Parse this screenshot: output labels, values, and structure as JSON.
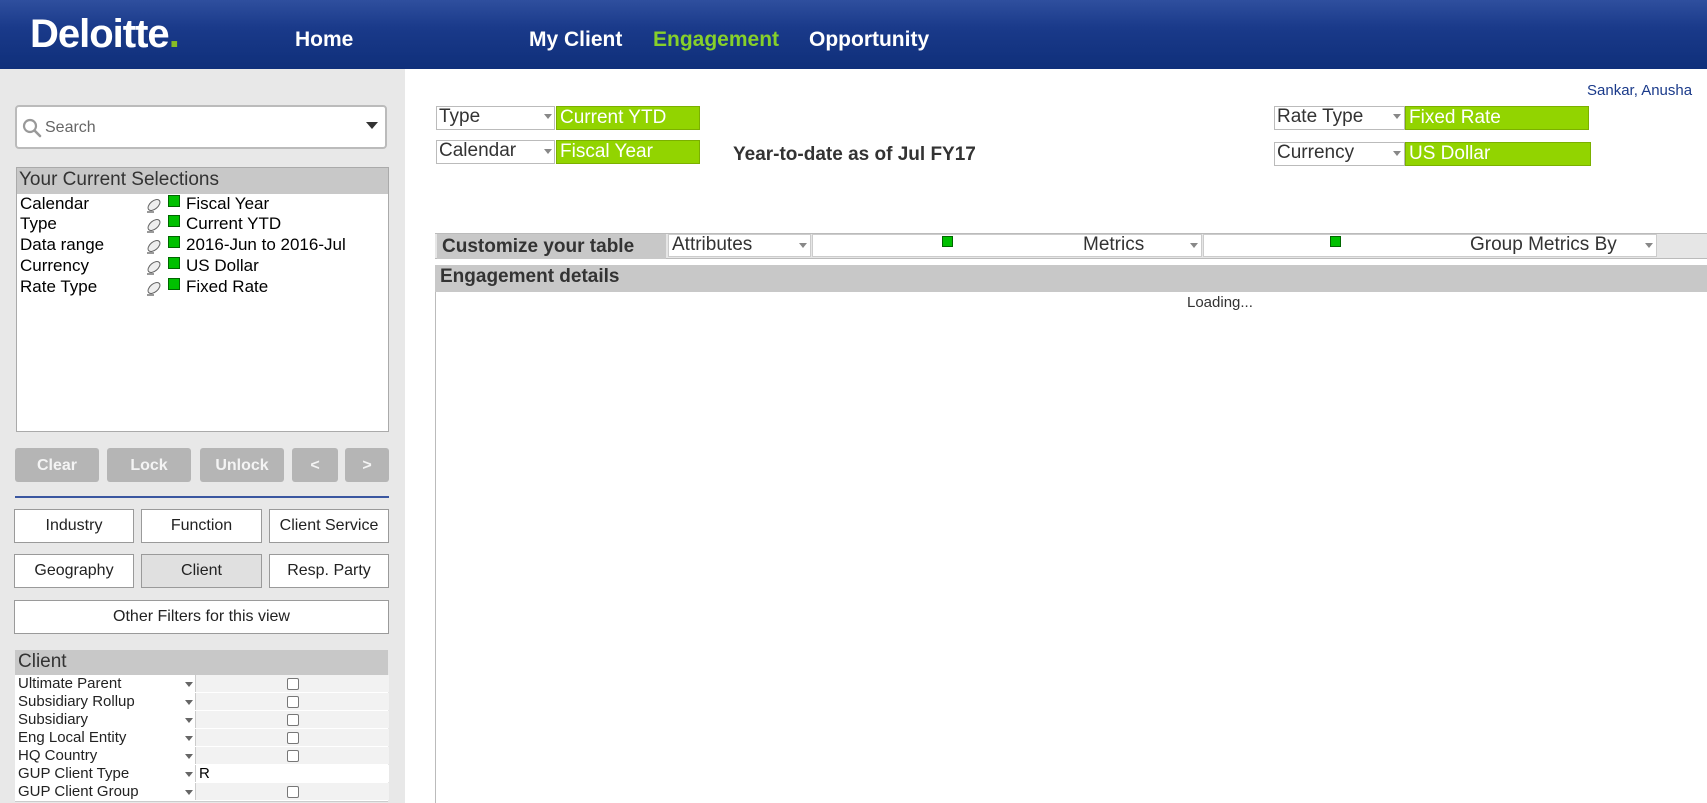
{
  "header": {
    "logo": "Deloitte",
    "logo_dot": ".",
    "nav": {
      "home": "Home",
      "my_client": "My Client",
      "engagement": "Engagement",
      "opportunity": "Opportunity"
    },
    "active_color": "#86d02a"
  },
  "search": {
    "placeholder": "Search"
  },
  "current_selections": {
    "title": "Your Current Selections",
    "items": [
      {
        "label": "Calendar",
        "value": "Fiscal Year"
      },
      {
        "label": "Type",
        "value": "Current YTD"
      },
      {
        "label": "Data range",
        "value": "2016-Jun to 2016-Jul"
      },
      {
        "label": "Currency",
        "value": "US Dollar"
      },
      {
        "label": "Rate Type",
        "value": "Fixed Rate"
      }
    ]
  },
  "selection_buttons": {
    "clear": "Clear",
    "lock": "Lock",
    "unlock": "Unlock",
    "prev": "<",
    "next": ">"
  },
  "filter_tabs": {
    "industry": "Industry",
    "function": "Function",
    "client_service": "Client Service",
    "geography": "Geography",
    "client": "Client",
    "resp_party": "Resp. Party",
    "other": "Other Filters for this view"
  },
  "client_panel": {
    "title": "Client",
    "fields": [
      {
        "label": "Ultimate Parent",
        "value": ""
      },
      {
        "label": "Subsidiary Rollup",
        "value": ""
      },
      {
        "label": "Subsidiary",
        "value": ""
      },
      {
        "label": "Eng Local Entity",
        "value": ""
      },
      {
        "label": "HQ Country",
        "value": ""
      },
      {
        "label": "GUP Client Type",
        "value": "R"
      },
      {
        "label": "GUP Client Group",
        "value": ""
      }
    ]
  },
  "user": {
    "name": "Sankar, Anusha"
  },
  "controls": {
    "type_label": "Type",
    "type_value": "Current YTD",
    "calendar_label": "Calendar",
    "calendar_value": "Fiscal Year",
    "rate_type_label": "Rate Type",
    "rate_type_value": "Fixed Rate",
    "currency_label": "Currency",
    "currency_value": "US Dollar",
    "ytd_text": "Year-to-date as of Jul FY17"
  },
  "customize": {
    "label": "Customize your table",
    "attributes": "Attributes",
    "metrics": "Metrics",
    "group_by": "Group Metrics By"
  },
  "engagement": {
    "title": "Engagement details",
    "loading": "Loading..."
  }
}
